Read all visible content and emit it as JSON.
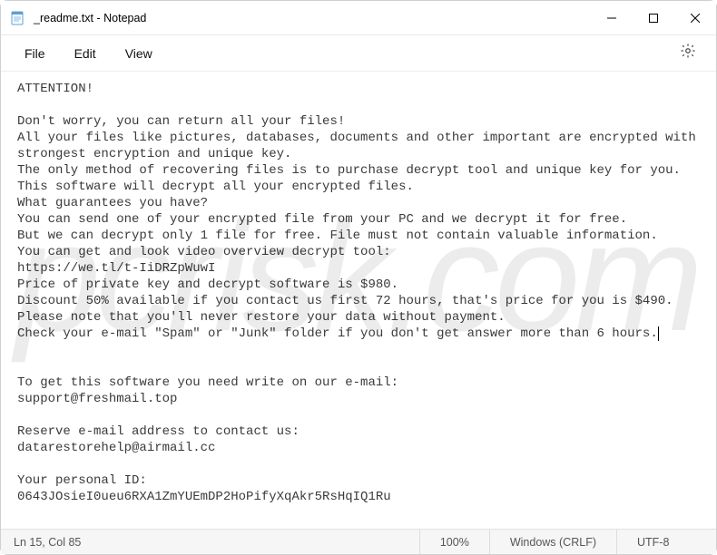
{
  "window": {
    "title": "_readme.txt - Notepad"
  },
  "menu": {
    "file": "File",
    "edit": "Edit",
    "view": "View"
  },
  "content": {
    "l01": "ATTENTION!",
    "l02": "",
    "l03": "Don't worry, you can return all your files!",
    "l04": "All your files like pictures, databases, documents and other important are encrypted with",
    "l05": "strongest encryption and unique key.",
    "l06": "The only method of recovering files is to purchase decrypt tool and unique key for you.",
    "l07": "This software will decrypt all your encrypted files.",
    "l08": "What guarantees you have?",
    "l09": "You can send one of your encrypted file from your PC and we decrypt it for free.",
    "l10": "But we can decrypt only 1 file for free. File must not contain valuable information.",
    "l11": "You can get and look video overview decrypt tool:",
    "l12": "https://we.tl/t-IiDRZpWuwI",
    "l13": "Price of private key and decrypt software is $980.",
    "l14": "Discount 50% available if you contact us first 72 hours, that's price for you is $490.",
    "l15": "Please note that you'll never restore your data without payment.",
    "l16": "Check your e-mail \"Spam\" or \"Junk\" folder if you don't get answer more than 6 hours.",
    "l17": "",
    "l18": "",
    "l19": "To get this software you need write on our e-mail:",
    "l20": "support@freshmail.top",
    "l21": "",
    "l22": "Reserve e-mail address to contact us:",
    "l23": "datarestorehelp@airmail.cc",
    "l24": "",
    "l25": "Your personal ID:",
    "l26": "0643JOsieI0ueu6RXA1ZmYUEmDP2HoPifyXqAkr5RsHqIQ1Ru"
  },
  "status": {
    "pos": "Ln 15, Col 85",
    "zoom": "100%",
    "eol": "Windows (CRLF)",
    "encoding": "UTF-8"
  },
  "watermark": "pcrisk.com"
}
